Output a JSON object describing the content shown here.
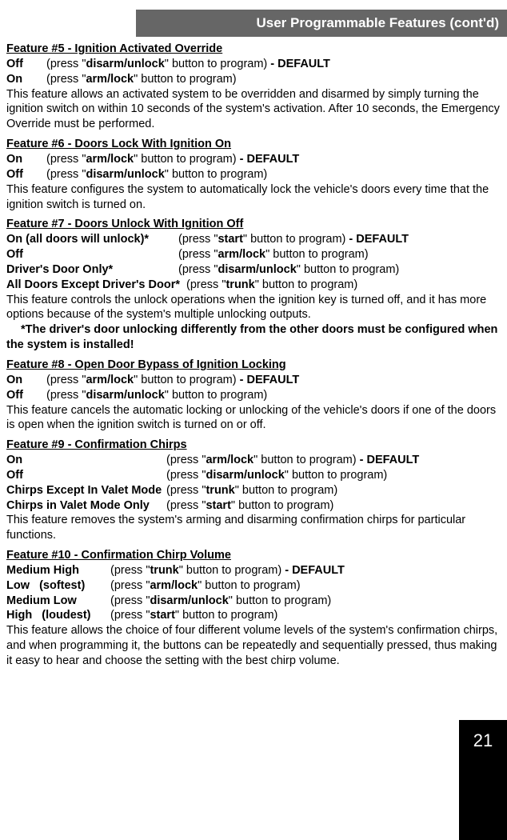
{
  "header": "User Programmable Features (cont'd)",
  "page_number": "21",
  "features": {
    "f5": {
      "title": "Feature #5 - Ignition Activated Override",
      "opts": [
        {
          "label": "Off",
          "pre": "(press \"",
          "btn": "disarm/unlock",
          "post": "\" button to program)",
          "suffix": " - DEFAULT"
        },
        {
          "label": "On",
          "pre": "(press \"",
          "btn": "arm/lock",
          "post": "\" button to program)",
          "suffix": ""
        }
      ],
      "desc": "This feature allows an activated system to be overridden and disarmed by simply turning the ignition switch on within 10 seconds of the system's activation.  After 10 seconds, the Emergency Override must be performed."
    },
    "f6": {
      "title": "Feature #6 - Doors Lock With Ignition On",
      "opts": [
        {
          "label": "On",
          "pre": "(press \"",
          "btn": "arm/lock",
          "post": "\" button to program)",
          "suffix": " - DEFAULT"
        },
        {
          "label": "Off",
          "pre": "(press \"",
          "btn": "disarm/unlock",
          "post": "\" button to program)",
          "suffix": ""
        }
      ],
      "desc": "This feature configures the system to automatically lock the vehicle's doors every time that the ignition switch is turned on."
    },
    "f7": {
      "title": "Feature #7 - Doors Unlock With Ignition Off",
      "opts": [
        {
          "label": "On (all doors will unlock)*",
          "pre": "(press \"",
          "btn": "start",
          "post": "\" button  to program)",
          "suffix": " - DEFAULT"
        },
        {
          "label": "Off",
          "pre": "(press \"",
          "btn": "arm/lock",
          "post": "\" button to program)",
          "suffix": ""
        },
        {
          "label": "Driver's Door Only*",
          "pre": "(press \"",
          "btn": "disarm/unlock",
          "post": "\" button  to program)",
          "suffix": ""
        },
        {
          "label": "All Doors Except Driver's Door*",
          "pre": "(press \"",
          "btn": "trunk",
          "post": "\" button  to program)",
          "suffix": ""
        }
      ],
      "desc": "This feature controls the unlock operations when the ignition key is turned off, and it has more options because of the system's multiple unlocking outputs.",
      "note": "*The driver's door unlocking differently from the other doors must be configured when the system is installed!"
    },
    "f8": {
      "title": "Feature #8 - Open Door Bypass of Ignition Locking",
      "opts": [
        {
          "label": "On",
          "pre": "(press \"",
          "btn": "arm/lock",
          "post": "\" button to program)",
          "suffix": " - DEFAULT"
        },
        {
          "label": "Off",
          "pre": "(press \"",
          "btn": "disarm/unlock",
          "post": "\" button to program)",
          "suffix": ""
        }
      ],
      "desc": "This feature cancels the automatic locking or unlocking of the vehicle's doors if one of the doors is open when the ignition switch is turned on or off."
    },
    "f9": {
      "title": "Feature #9 - Confirmation Chirps",
      "opts": [
        {
          "label": "On",
          "pre": "(press \"",
          "btn": "arm/lock",
          "post": "\" button to program)",
          "suffix": " - DEFAULT"
        },
        {
          "label": "Off",
          "pre": "(press \"",
          "btn": "disarm/unlock",
          "post": "\" button to program)",
          "suffix": ""
        },
        {
          "label": "Chirps Except In Valet Mode",
          "pre": "(press \"",
          "btn": "trunk",
          "post": "\" button  to program)",
          "suffix": ""
        },
        {
          "label": "Chirps in Valet Mode Only",
          "pre": "(press \"",
          "btn": "start",
          "post": "\" button  to program)",
          "suffix": ""
        }
      ],
      "desc": "This feature removes the system's arming and disarming confirmation chirps for particular functions."
    },
    "f10": {
      "title": "Feature #10 - Confirmation Chirp Volume ",
      "opts": [
        {
          "label": "Medium High",
          "pre": "(press \"",
          "btn": "trunk",
          "post": "\" button  to program)",
          "suffix": " - DEFAULT"
        },
        {
          "label": "Low   (softest)",
          "pre": "(press \"",
          "btn": "arm/lock",
          "post": "\" button to program)",
          "suffix": ""
        },
        {
          "label": "Medium Low",
          "pre": "(press \"",
          "btn": "disarm/unlock",
          "post": "\" button  to program)",
          "suffix": ""
        },
        {
          "label": "High   (loudest)",
          "pre": "(press \"",
          "btn": "start",
          "post": "\" button  to program)",
          "suffix": ""
        }
      ],
      "desc": "This feature allows the choice of four different volume levels of the system's confirmation chirps, and when programming it, the buttons can be repeatedly and sequentially pressed, thus making it easy to hear and choose the setting with the best chirp volume."
    }
  }
}
